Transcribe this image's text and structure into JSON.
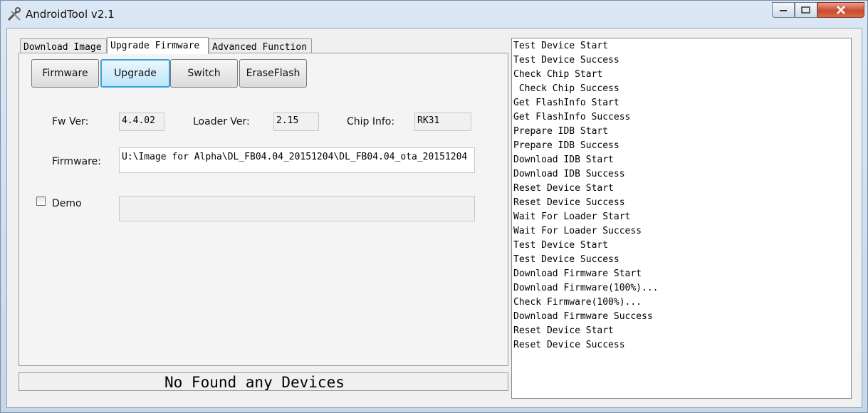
{
  "window": {
    "title": "AndroidTool v2.1"
  },
  "tabs": [
    {
      "label": "Download Image"
    },
    {
      "label": "Upgrade Firmware"
    },
    {
      "label": "Advanced Function"
    }
  ],
  "toolbar": {
    "firmware_label": "Firmware",
    "upgrade_label": "Upgrade",
    "switch_label": "Switch",
    "eraseflash_label": "EraseFlash"
  },
  "info": {
    "fw_ver_label": "Fw Ver:",
    "fw_ver_value": "4.4.02",
    "loader_ver_label": "Loader Ver:",
    "loader_ver_value": "2.15",
    "chip_info_label": "Chip Info:",
    "chip_info_value": "RK31",
    "firmware_label": "Firmware:",
    "firmware_path": "U:\\Image for Alpha\\DL_FB04.04_20151204\\DL_FB04.04_ota_20151204",
    "demo_label": "Demo",
    "demo_checked": false,
    "demo_value": ""
  },
  "status_text": "No Found any Devices",
  "log": [
    "Test Device Start",
    "Test Device Success",
    "Check Chip Start",
    " Check Chip Success",
    "Get FlashInfo Start",
    "Get FlashInfo Success",
    "Prepare IDB Start",
    "Prepare IDB Success",
    "Download IDB Start",
    "Download IDB Success",
    "Reset Device Start",
    "Reset Device Success",
    "Wait For Loader Start",
    "Wait For Loader Success",
    "Test Device Start",
    "Test Device Success",
    "Download Firmware Start",
    "Download Firmware(100%)...",
    "Check Firmware(100%)...",
    "Download Firmware Success",
    "Reset Device Start",
    "Reset Device Success"
  ],
  "colors": {
    "accent": "#3c9fd8",
    "close_button": "#c94a2d"
  },
  "icons": {
    "app": "tools-icon",
    "minimize": "minimize-icon",
    "maximize": "maximize-icon",
    "close": "close-icon"
  }
}
